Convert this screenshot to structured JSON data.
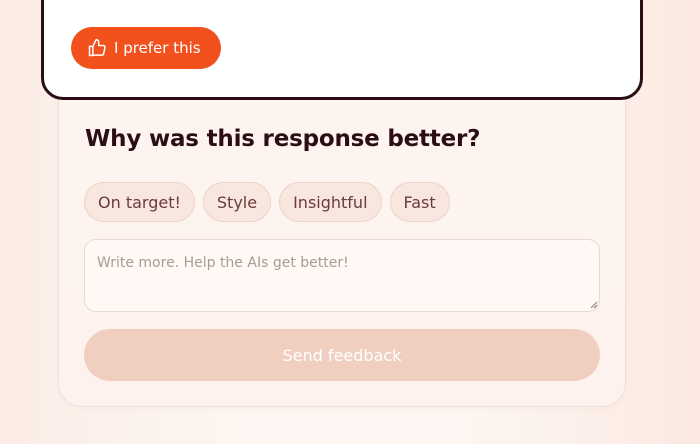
{
  "response_card": {
    "prefer_label": "I prefer this",
    "prefer_icon": "thumbs-up-icon"
  },
  "feedback": {
    "title": "Why was this response better?",
    "chips": [
      {
        "label": "On target!"
      },
      {
        "label": "Style"
      },
      {
        "label": "Insightful"
      },
      {
        "label": "Fast"
      }
    ],
    "comment_placeholder": "Write more. Help the AIs get better!",
    "comment_value": "",
    "send_label": "Send feedback"
  },
  "colors": {
    "accent": "#f2511d",
    "card_border": "#2b0d16",
    "send_disabled": "#f1cfc0",
    "chip_bg": "#f8e7df"
  }
}
